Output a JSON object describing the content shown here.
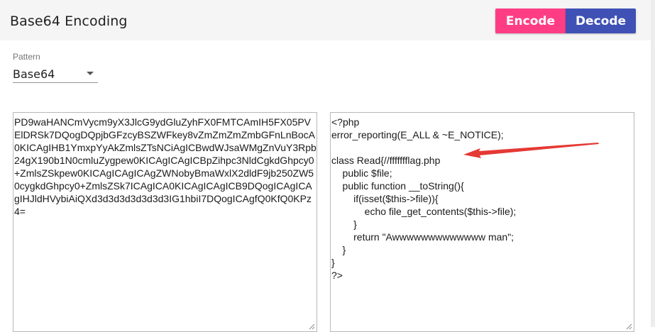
{
  "header": {
    "title": "Base64 Encoding",
    "encode_label": "Encode",
    "decode_label": "Decode"
  },
  "pattern": {
    "label": "Pattern",
    "value": "Base64"
  },
  "input": {
    "text": "PD9waHANCmVycm9yX3JlcG9ydGluZyhFX0FMTCAmIH5FX05PVElDRSk7DQogDQpjbGFzcyBSZWFkey8vZmZmZmZmbGFnLnBocA0KICAgIHB1YmxpYyAkZmlsZTsNCiAgICBwdWJsaWMgZnVuY3Rpb24gX190b1N0cmluZygpew0KICAgICAgICBpZihpc3NldCgkdGhpcy0+ZmlsZSkpew0KICAgICAgICAgZWNobyBmaWxlX2dldF9jb250ZW50cygkdGhpcy0+ZmlsZSk7ICAgICA0KICAgICAgICB9DQogICAgICAgIHJldHVybiAiQXd3d3d3d3d3d3d3IG1hbiI7DQogICAgfQ0KfQ0KPz4="
  },
  "output": {
    "lines": [
      "<?php",
      "error_reporting(E_ALL & ~E_NOTICE);",
      "",
      "class Read{//ffffffflag.php",
      "    public $file;",
      "    public function __toString(){",
      "        if(isset($this->file)){",
      "            echo file_get_contents($this->file);",
      "        }",
      "        return \"Awwwwwwwwwwwww man\";",
      "    }",
      "}",
      "?>"
    ]
  },
  "colors": {
    "encode": "#ff3d84",
    "decode": "#3f51b5",
    "annotation_arrow": "#e53935"
  },
  "annotation": {
    "icon": "red-arrow-icon"
  }
}
